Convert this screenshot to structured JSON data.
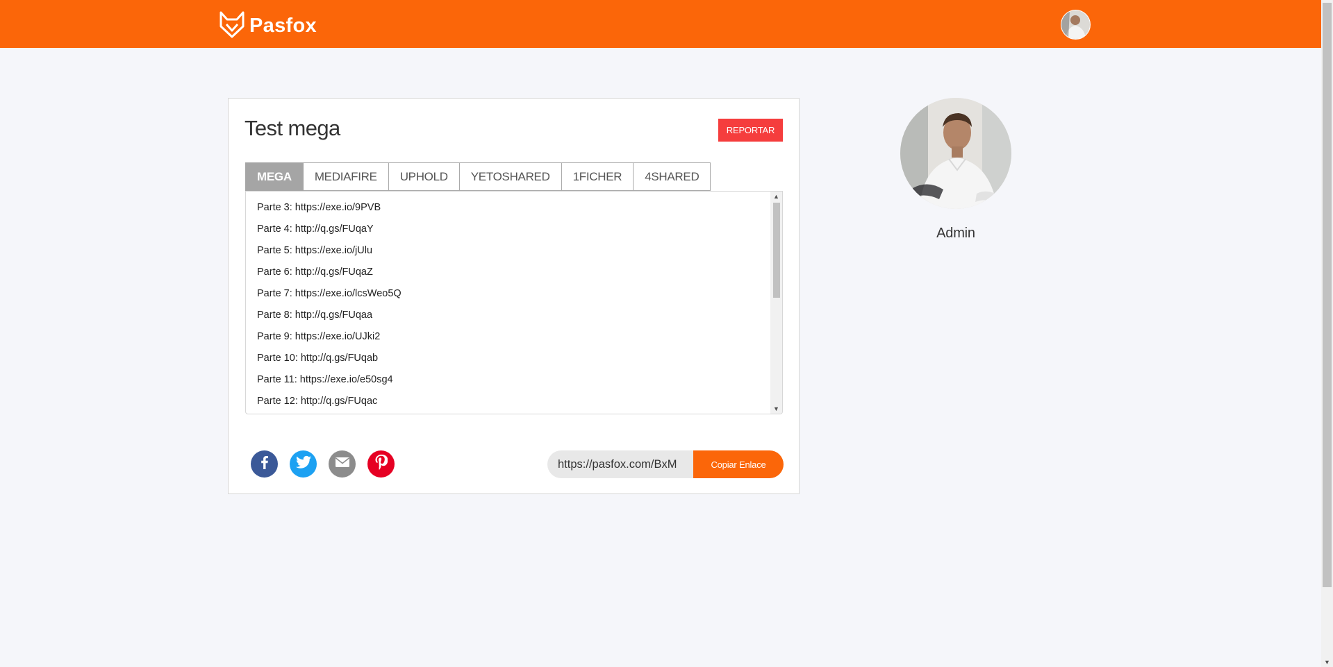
{
  "header": {
    "brand_name": "Pasfox",
    "brand_color": "#fb6609",
    "logo_icon": "fox-icon"
  },
  "post": {
    "title": "Test mega",
    "report_label": "REPORTAR"
  },
  "tabs": [
    {
      "label": "MEGA",
      "active": true
    },
    {
      "label": "MEDIAFIRE",
      "active": false
    },
    {
      "label": "UPHOLD",
      "active": false
    },
    {
      "label": "YETOSHARED",
      "active": false
    },
    {
      "label": "1FICHER",
      "active": false
    },
    {
      "label": "4SHARED",
      "active": false
    }
  ],
  "links": [
    "Parte 3: https://exe.io/9PVB",
    "Parte 4: http://q.gs/FUqaY",
    "Parte 5: https://exe.io/jUlu",
    "Parte 6: http://q.gs/FUqaZ",
    "Parte 7: https://exe.io/lcsWeo5Q",
    "Parte 8: http://q.gs/FUqaa",
    "Parte 9: https://exe.io/UJki2",
    "Parte 10: http://q.gs/FUqab",
    "Parte 11: https://exe.io/e50sg4",
    "Parte 12: http://q.gs/FUqac"
  ],
  "share": {
    "buttons": [
      {
        "name": "facebook-icon",
        "color": "#3b5998"
      },
      {
        "name": "twitter-icon",
        "color": "#1da1f2"
      },
      {
        "name": "email-icon",
        "color": "#8c8c8c"
      },
      {
        "name": "pinterest-icon",
        "color": "#e60023"
      }
    ],
    "copy_value": "https://pasfox.com/BxM",
    "copy_label": "Copiar Enlace"
  },
  "profile": {
    "name": "Admin"
  }
}
